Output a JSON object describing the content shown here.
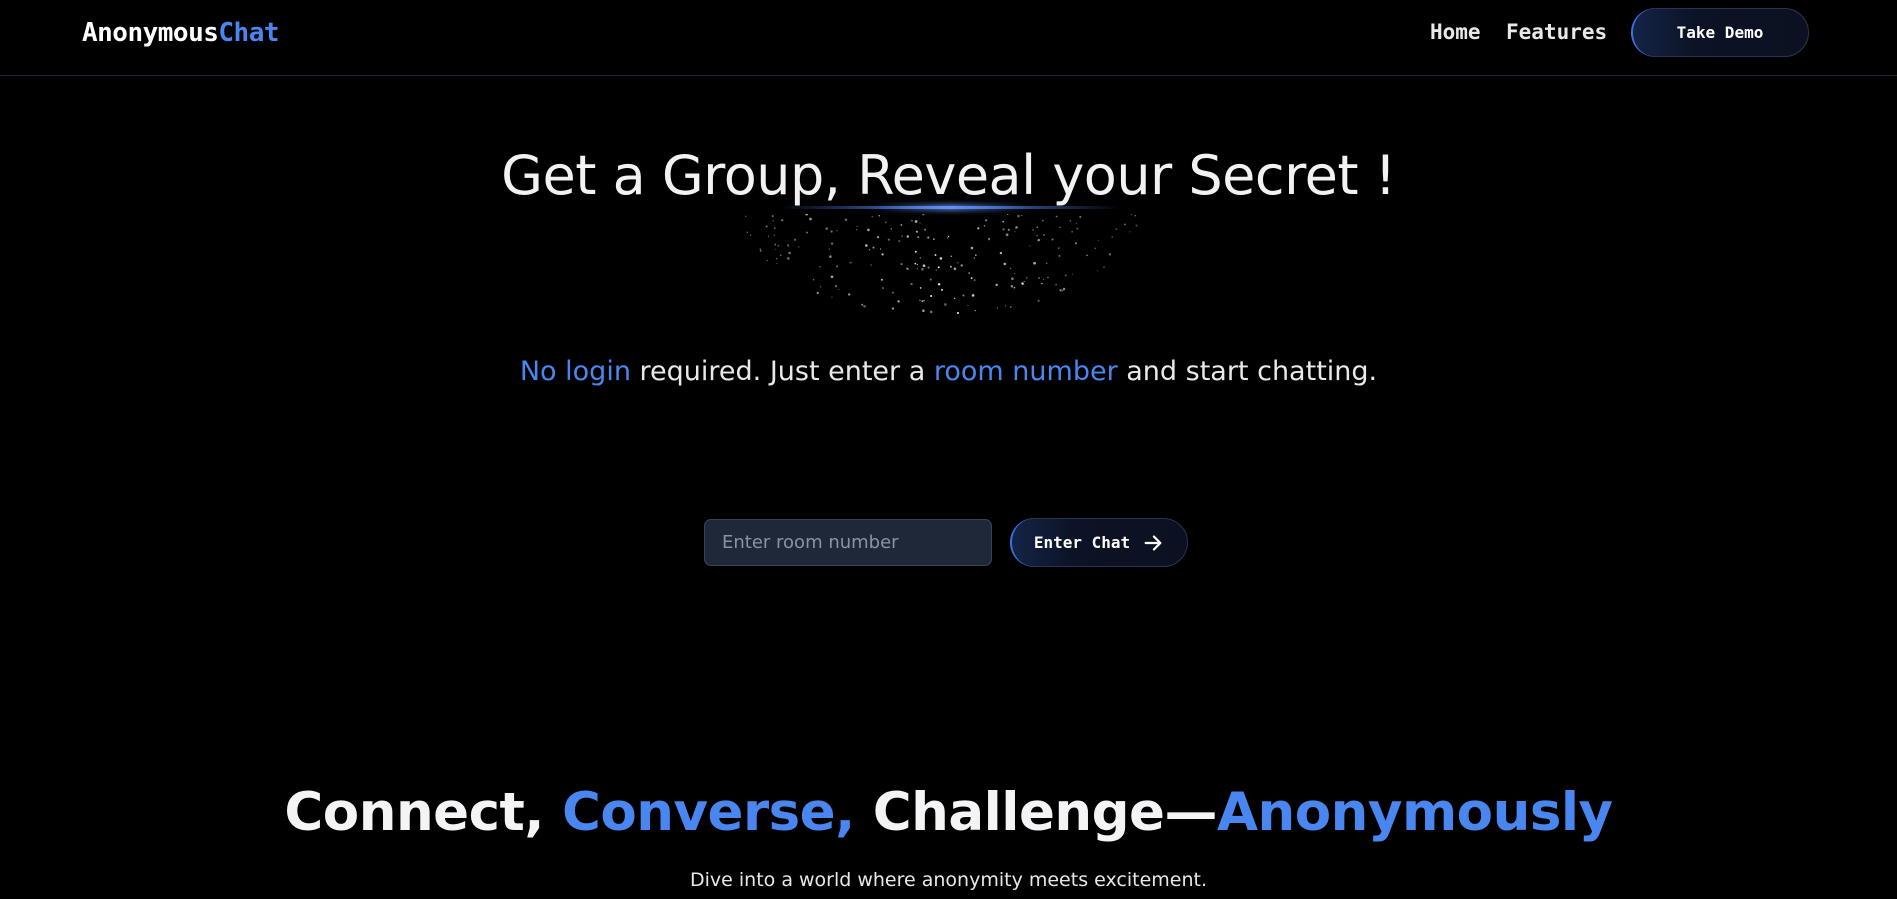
{
  "navbar": {
    "logo_main": "Anonymous",
    "logo_accent": "Chat",
    "links": [
      "Home",
      "Features"
    ],
    "demo_button": "Take Demo"
  },
  "hero": {
    "title": "Get a Group, Reveal your Secret !",
    "tagline_hl1": "No login",
    "tagline_mid1": " required. Just enter a ",
    "tagline_hl2": "room number",
    "tagline_end": " and start chatting."
  },
  "join": {
    "placeholder": "Enter room number",
    "value": "",
    "button_label": "Enter Chat",
    "button_icon": "arrow-right-icon"
  },
  "features": {
    "title_1": "Connect, ",
    "title_2": "Converse,",
    "title_3": " Challenge—",
    "title_4": "Anonymously",
    "subtitle": "Dive into a world where anonymity meets excitement."
  },
  "colors": {
    "background": "#000000",
    "accent": "#4a86f0",
    "button_bg": "#0c1326",
    "input_bg": "#1f2838"
  }
}
